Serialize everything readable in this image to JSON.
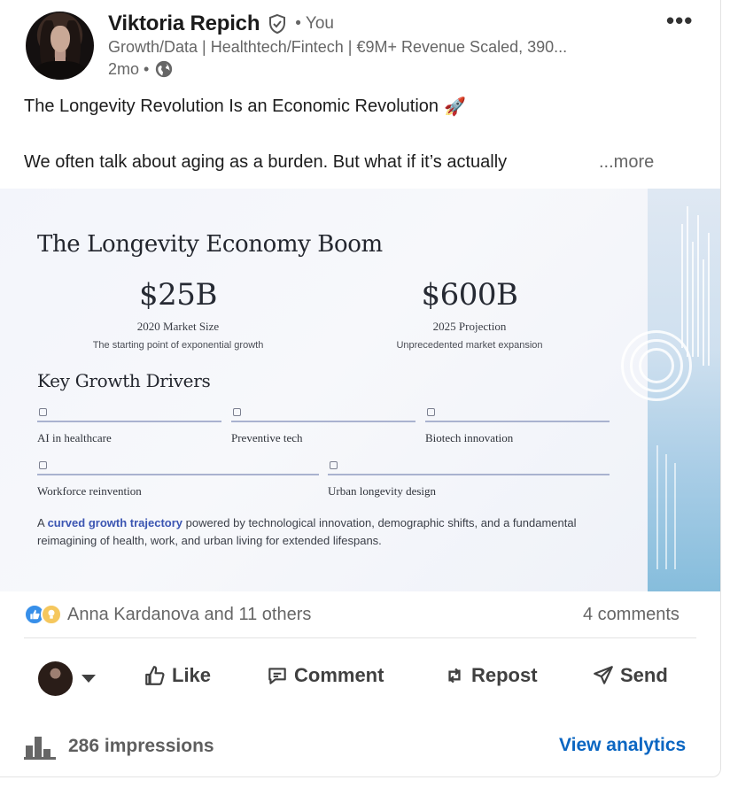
{
  "post": {
    "author": {
      "name": "Viktoria Repich",
      "you_label": "• You",
      "headline": "Growth/Data | Healthtech/Fintech | €9M+ Revenue Scaled, 390...",
      "time": "2mo •"
    },
    "title": "The Longevity Revolution Is an Economic Revolution",
    "title_emoji": "🚀",
    "body_preview": "We often talk about aging as a burden. But what if it’s actually",
    "see_more": "...more"
  },
  "image": {
    "title": "The Longevity Economy Boom",
    "stats": [
      {
        "value": "$25B",
        "label": "2020 Market Size",
        "sub": "The starting point of exponential growth"
      },
      {
        "value": "$600B",
        "label": "2025 Projection",
        "sub": "Unprecedented market expansion"
      }
    ],
    "drivers_title": "Key Growth Drivers",
    "drivers": [
      {
        "label": "AI in healthcare"
      },
      {
        "label": "Preventive tech"
      },
      {
        "label": "Biotech innovation"
      },
      {
        "label": "Workforce reinvention"
      },
      {
        "label": "Urban longevity design"
      }
    ],
    "desc_prefix": "A ",
    "desc_highlight": "curved growth trajectory",
    "desc_suffix": " powered by technological innovation, demographic shifts, and a fundamental reimagining of health, work, and urban living for extended lifespans."
  },
  "social": {
    "reactions_text": "Anna Kardanova and 11 others",
    "comments_text": "4 comments"
  },
  "actions": {
    "like": "Like",
    "comment": "Comment",
    "repost": "Repost",
    "send": "Send"
  },
  "footer": {
    "impressions": "286 impressions",
    "analytics": "View analytics"
  },
  "colors": {
    "link": "#0a66c2",
    "like_reaction": "#378fe9",
    "idea_reaction": "#f5c75d",
    "highlight_text": "#3b55b2"
  },
  "icons": [
    "verified-shield-icon",
    "globe-icon",
    "more-options-icon",
    "rocket-emoji",
    "like-reaction-icon",
    "insightful-reaction-icon",
    "thumbs-up-icon",
    "comment-icon",
    "repost-icon",
    "send-icon",
    "bar-chart-icon",
    "caret-down-icon"
  ]
}
